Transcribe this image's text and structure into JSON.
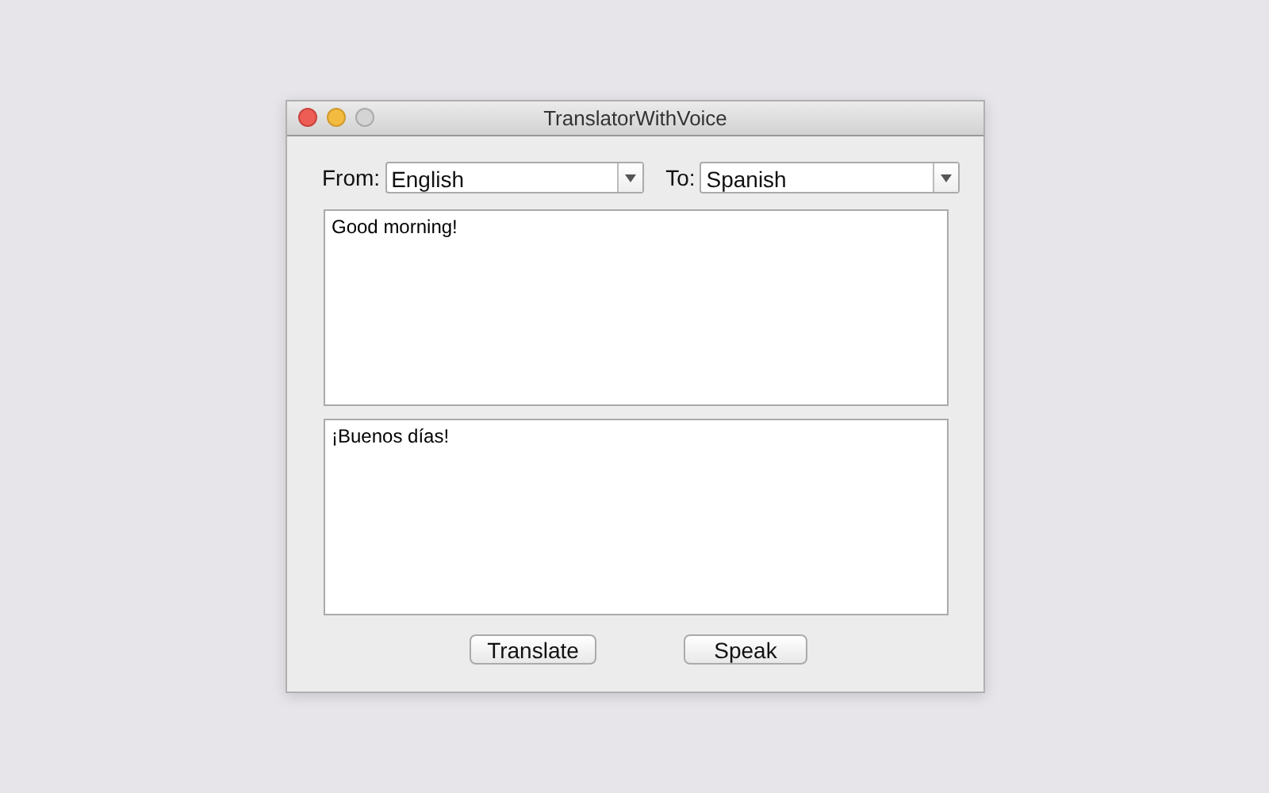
{
  "window": {
    "title": "TranslatorWithVoice"
  },
  "from": {
    "label": "From:",
    "value": "English"
  },
  "to": {
    "label": "To:",
    "value": "Spanish"
  },
  "source_text": "Good morning!",
  "translated_text": "¡Buenos días!",
  "buttons": [
    "Translate",
    "Speak"
  ]
}
